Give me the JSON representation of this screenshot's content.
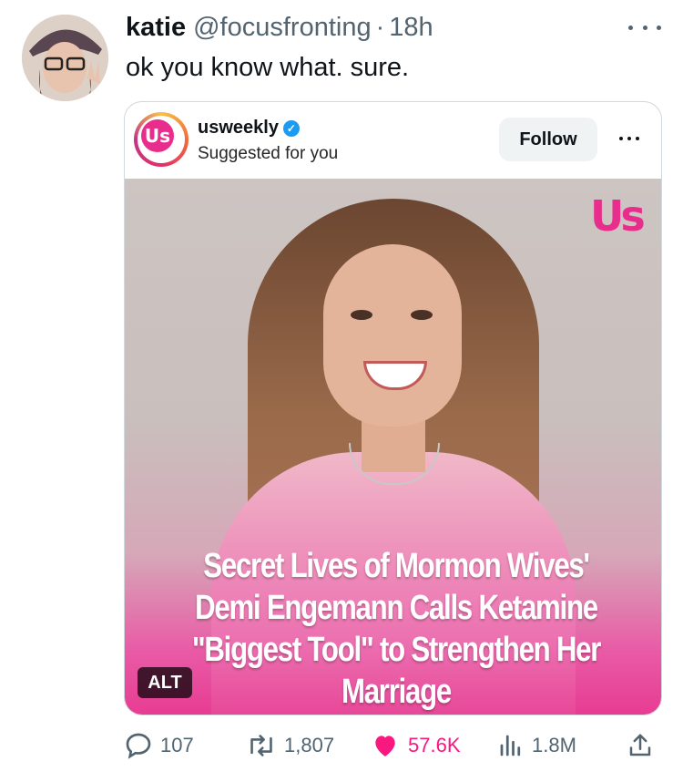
{
  "tweet": {
    "author_name": "katie",
    "author_handle": "@focusfronting",
    "separator": "·",
    "time": "18h",
    "text": "ok you know what. sure."
  },
  "embed": {
    "username": "usweekly",
    "subtitle": "Suggested for you",
    "follow_label": "Follow",
    "logo_text": "Us",
    "watermark": "Us",
    "headline": "Secret Lives of Mormon Wives' Demi Engemann Calls Ketamine \"Biggest Tool\" to Strengthen Her Marriage",
    "alt_label": "ALT",
    "brand_color": "#e82d8c"
  },
  "metrics": {
    "replies": "107",
    "reposts": "1,807",
    "likes": "57.6K",
    "views": "1.8M",
    "like_color": "#f91880"
  },
  "icons": [
    "more-icon",
    "verified-icon",
    "reply-icon",
    "repost-icon",
    "heart-icon",
    "views-icon",
    "share-icon"
  ]
}
